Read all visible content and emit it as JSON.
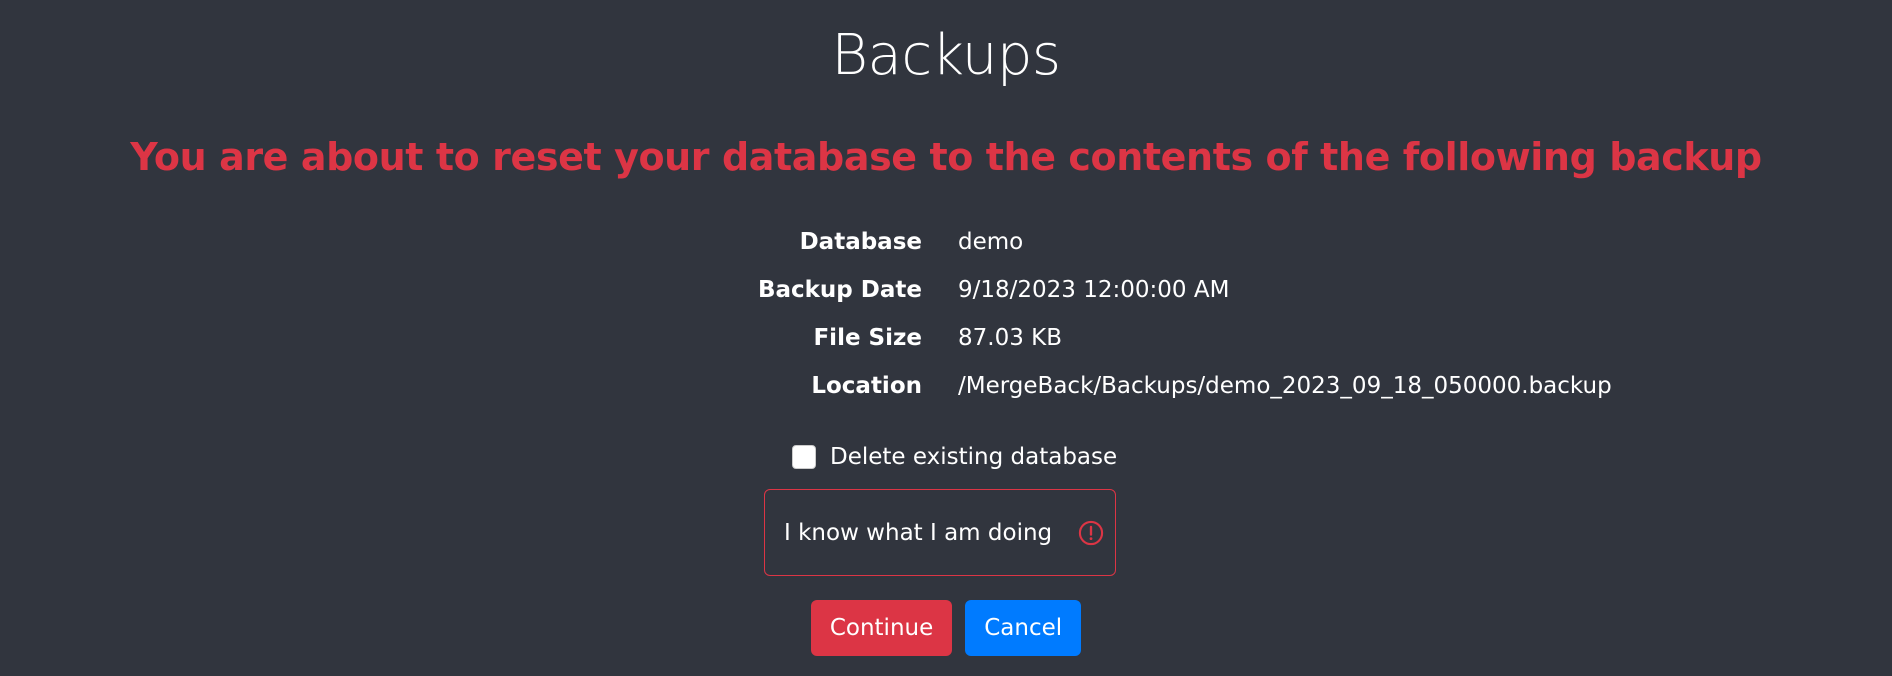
{
  "page": {
    "title": "Backups",
    "warning": "You are about to reset your database to the contents of the following backup"
  },
  "details": [
    {
      "label": "Database",
      "value": "demo"
    },
    {
      "label": "Backup Date",
      "value": "9/18/2023 12:00:00 AM"
    },
    {
      "label": "File Size",
      "value": "87.03 KB"
    },
    {
      "label": "Location",
      "value": "/MergeBack/Backups/demo_2023_09_18_050000.backup"
    }
  ],
  "form": {
    "delete_checkbox_label": "Delete existing database",
    "delete_checked": false,
    "confirm_input_value": "I know what I am doing",
    "confirm_input_state": "invalid"
  },
  "buttons": {
    "continue_label": "Continue",
    "cancel_label": "Cancel"
  },
  "colors": {
    "background": "#31353e",
    "danger": "#dc3545",
    "primary": "#007bff",
    "text": "#ffffff"
  },
  "icons": {
    "input_status": "exclamation-circle-icon"
  }
}
